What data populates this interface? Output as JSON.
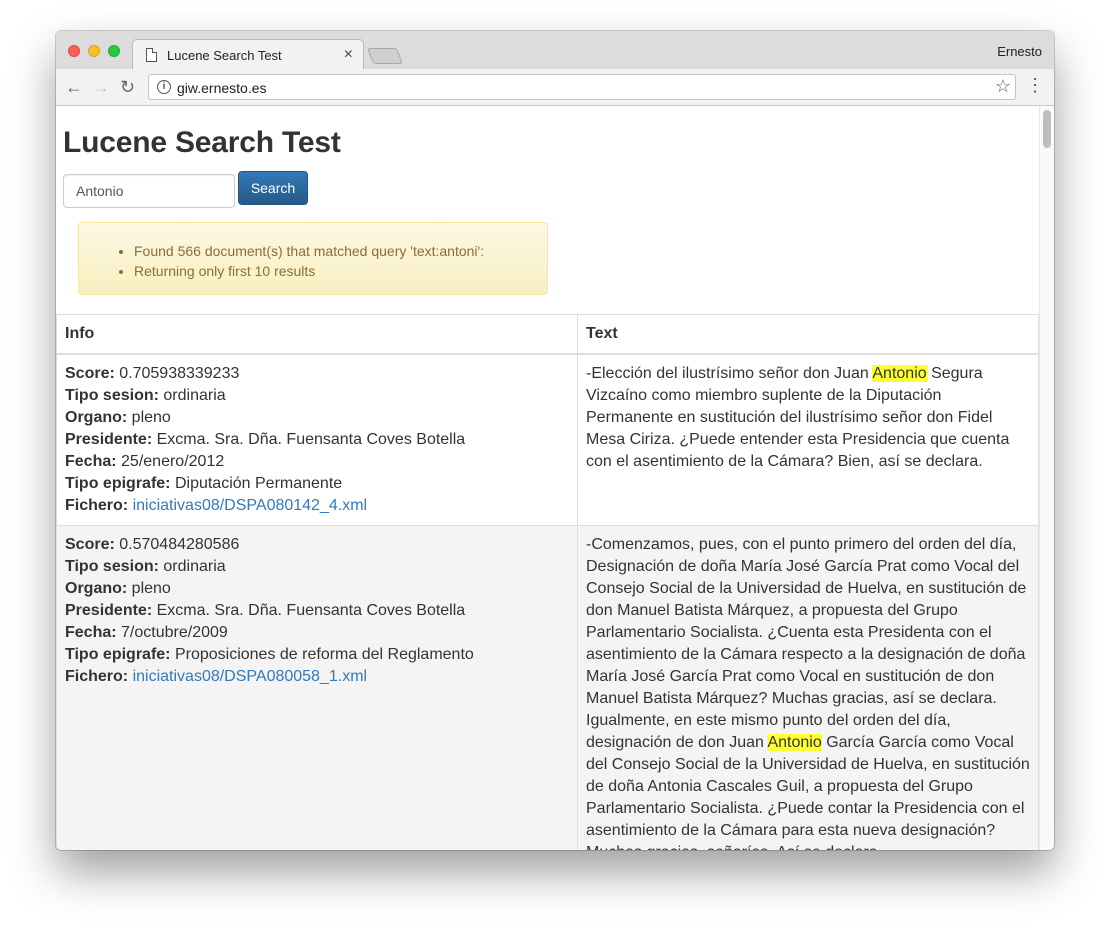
{
  "browser": {
    "tab_title": "Lucene Search Test",
    "tab_close": "×",
    "profile_name": "Ernesto",
    "url": "giw.ernesto.es",
    "nav_back": "←",
    "nav_forward": "→",
    "nav_reload": "↻",
    "bookmark_star": "☆",
    "menu": "⋮",
    "info_glyph": "i"
  },
  "page": {
    "heading": "Lucene Search Test",
    "search": {
      "value": "Antonio",
      "button_label": "Search"
    },
    "alert": {
      "lines": [
        "Found 566 document(s) that matched query 'text:antoni':",
        "Returning only first 10 results"
      ]
    },
    "table": {
      "headers": {
        "info": "Info",
        "text": "Text"
      },
      "labels": {
        "score": "Score:",
        "tipo_sesion": "Tipo sesion:",
        "organo": "Organo:",
        "presidente": "Presidente:",
        "fecha": "Fecha:",
        "tipo_epigrafe": "Tipo epigrafe:",
        "fichero": "Fichero:"
      },
      "rows": [
        {
          "score": "0.705938339233",
          "tipo_sesion": "ordinaria",
          "organo": "pleno",
          "presidente": "Excma. Sra. Dña. Fuensanta Coves Botella",
          "fecha": "25/enero/2012",
          "tipo_epigrafe": "Diputación Permanente",
          "fichero": "iniciativas08/DSPA080142_4.xml",
          "text_before": "-Elección del ilustrísimo señor don Juan ",
          "highlight": "Antonio",
          "text_after": " Segura Vizcaíno como miembro suplente de la Diputación Permanente en sustitución del ilustrísimo señor don Fidel Mesa Ciriza. ¿Puede entender esta Presidencia que cuenta con el asentimiento de la Cámara? Bien, así se declara."
        },
        {
          "score": "0.570484280586",
          "tipo_sesion": "ordinaria",
          "organo": "pleno",
          "presidente": "Excma. Sra. Dña. Fuensanta Coves Botella",
          "fecha": "7/octubre/2009",
          "tipo_epigrafe": "Proposiciones de reforma del Reglamento",
          "fichero": "iniciativas08/DSPA080058_1.xml",
          "text_before": "-Comenzamos, pues, con el punto primero del orden del día, Designación de doña María José García Prat como Vocal del Consejo Social de la Universidad de Huelva, en sustitución de don Manuel Batista Márquez, a propuesta del Grupo Parlamentario Socialista. ¿Cuenta esta Presidenta con el asentimiento de la Cámara respecto a la designación de doña María José García Prat como Vocal en sustitución de don Manuel Batista Márquez? Muchas gracias, así se declara. Igualmente, en este mismo punto del orden del día, designación de don Juan ",
          "highlight": "Antonio",
          "text_after": " García García como Vocal del Consejo Social de la Universidad de Huelva, en sustitución de doña Antonia Cascales Guil, a propuesta del Grupo Parlamentario Socialista. ¿Puede contar la Presidencia con el asentimiento de la Cámara para esta nueva designación? Muchas gracias, señorías. Así se declara."
        }
      ]
    }
  },
  "colors": {
    "link": "#337ab7",
    "highlight": "#ffff33",
    "alert_text": "#8a6d3b",
    "button": "#337ab7"
  }
}
